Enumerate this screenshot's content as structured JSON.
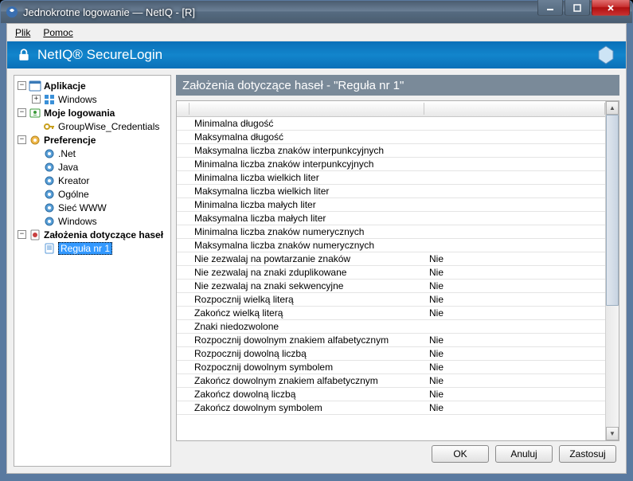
{
  "window": {
    "title": "Jednokrotne logowanie — NetIQ - [R]"
  },
  "menu": {
    "file": "Plik",
    "help": "Pomoc"
  },
  "brand": {
    "product": "NetIQ® SecureLogin"
  },
  "tree": {
    "applications": {
      "label": "Aplikacje",
      "expanded": true,
      "children": [
        {
          "label": "Windows",
          "icon": "windows"
        }
      ]
    },
    "mylogins": {
      "label": "Moje logowania",
      "expanded": true,
      "children": [
        {
          "label": "GroupWise_Credentials",
          "icon": "key"
        }
      ]
    },
    "preferences": {
      "label": "Preferencje",
      "expanded": true,
      "children": [
        {
          "label": ".Net",
          "icon": "gear-blue"
        },
        {
          "label": "Java",
          "icon": "gear-blue"
        },
        {
          "label": "Kreator",
          "icon": "gear-blue"
        },
        {
          "label": "Ogólne",
          "icon": "gear-blue"
        },
        {
          "label": "Sieć WWW",
          "icon": "gear-blue"
        },
        {
          "label": "Windows",
          "icon": "gear-blue"
        }
      ]
    },
    "policies": {
      "label": "Założenia dotyczące haseł",
      "expanded": true,
      "children": [
        {
          "label": "Reguła nr 1",
          "icon": "doc",
          "selected": true
        }
      ]
    }
  },
  "heading": "Założenia dotyczące haseł - \"Reguła nr 1\"",
  "rows": [
    {
      "name": "Minimalna długość",
      "value": ""
    },
    {
      "name": "Maksymalna długość",
      "value": ""
    },
    {
      "name": "Maksymalna liczba znaków interpunkcyjnych",
      "value": ""
    },
    {
      "name": "Minimalna liczba znaków interpunkcyjnych",
      "value": ""
    },
    {
      "name": "Minimalna liczba wielkich liter",
      "value": ""
    },
    {
      "name": "Maksymalna liczba wielkich liter",
      "value": ""
    },
    {
      "name": "Minimalna liczba małych liter",
      "value": ""
    },
    {
      "name": "Maksymalna liczba małych liter",
      "value": ""
    },
    {
      "name": "Minimalna liczba znaków numerycznych",
      "value": ""
    },
    {
      "name": "Maksymalna liczba znaków numerycznych",
      "value": ""
    },
    {
      "name": "Nie zezwalaj na powtarzanie znaków",
      "value": "Nie"
    },
    {
      "name": "Nie zezwalaj na znaki zduplikowane",
      "value": "Nie"
    },
    {
      "name": "Nie zezwalaj na znaki sekwencyjne",
      "value": "Nie"
    },
    {
      "name": "Rozpocznij wielką literą",
      "value": "Nie"
    },
    {
      "name": "Zakończ wielką literą",
      "value": "Nie"
    },
    {
      "name": "Znaki niedozwolone",
      "value": ""
    },
    {
      "name": "Rozpocznij dowolnym znakiem alfabetycznym",
      "value": "Nie"
    },
    {
      "name": "Rozpocznij dowolną liczbą",
      "value": "Nie"
    },
    {
      "name": "Rozpocznij dowolnym symbolem",
      "value": "Nie"
    },
    {
      "name": "Zakończ dowolnym znakiem alfabetycznym",
      "value": "Nie"
    },
    {
      "name": "Zakończ dowolną liczbą",
      "value": "Nie"
    },
    {
      "name": "Zakończ dowolnym symbolem",
      "value": "Nie"
    }
  ],
  "buttons": {
    "ok": "OK",
    "cancel": "Anuluj",
    "apply": "Zastosuj"
  }
}
